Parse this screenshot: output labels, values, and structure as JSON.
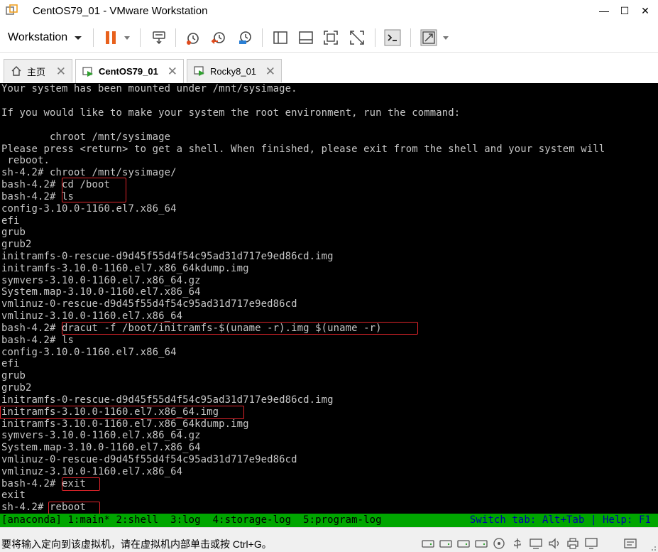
{
  "window": {
    "title": "CentOS79_01 - VMware Workstation",
    "minimize_glyph": "—",
    "maximize_glyph": "☐",
    "close_glyph": "✕"
  },
  "toolbar": {
    "workstation_menu_label": "Workstation",
    "buttons": [
      "pause-icon",
      "send-ctrl-alt-del-icon",
      "snapshot-take-icon",
      "snapshot-revert-icon",
      "snapshot-manager-icon",
      "show-library-icon",
      "thumbnail-bar-icon",
      "full-screen-icon",
      "unity-icon",
      "console-view-icon",
      "stretch-guest-icon"
    ]
  },
  "tabs": [
    {
      "label": "主页",
      "icon": "home-icon",
      "active": false
    },
    {
      "label": "CentOS79_01",
      "icon": "vm-running-icon",
      "active": true
    },
    {
      "label": "Rocky8_01",
      "icon": "vm-running-icon",
      "active": false
    }
  ],
  "console": {
    "lines": [
      "Your system has been mounted under /mnt/sysimage.",
      "",
      "If you would like to make your system the root environment, run the command:",
      "",
      "        chroot /mnt/sysimage",
      "Please press <return> to get a shell. When finished, please exit from the shell and your system will",
      " reboot.",
      "sh-4.2# chroot /mnt/sysimage/",
      "bash-4.2# cd /boot",
      "bash-4.2# ls",
      "config-3.10.0-1160.el7.x86_64",
      "efi",
      "grub",
      "grub2",
      "initramfs-0-rescue-d9d45f55d4f54c95ad31d717e9ed86cd.img",
      "initramfs-3.10.0-1160.el7.x86_64kdump.img",
      "symvers-3.10.0-1160.el7.x86_64.gz",
      "System.map-3.10.0-1160.el7.x86_64",
      "vmlinuz-0-rescue-d9d45f55d4f54c95ad31d717e9ed86cd",
      "vmlinuz-3.10.0-1160.el7.x86_64",
      "bash-4.2# dracut -f /boot/initramfs-$(uname -r).img $(uname -r)",
      "bash-4.2# ls",
      "config-3.10.0-1160.el7.x86_64",
      "efi",
      "grub",
      "grub2",
      "initramfs-0-rescue-d9d45f55d4f54c95ad31d717e9ed86cd.img",
      "initramfs-3.10.0-1160.el7.x86_64.img",
      "initramfs-3.10.0-1160.el7.x86_64kdump.img",
      "symvers-3.10.0-1160.el7.x86_64.gz",
      "System.map-3.10.0-1160.el7.x86_64",
      "vmlinuz-0-rescue-d9d45f55d4f54c95ad31d717e9ed86cd",
      "vmlinuz-3.10.0-1160.el7.x86_64",
      "bash-4.2# exit",
      "exit",
      "sh-4.2# reboot"
    ],
    "tmux_status_left": "[anaconda] 1:main* 2:shell  3:log  4:storage-log  5:program-log",
    "tmux_status_right": "Switch tab: Alt+Tab | Help: F1",
    "colors": {
      "background": "#000000",
      "text": "#c7c7c7",
      "status_bar": "#00a600",
      "status_right_text": "#0000a8",
      "highlight_box": "#e0242b"
    }
  },
  "statusbar": {
    "hint": "要将输入定向到该虚拟机，请在虚拟机内部单击或按 Ctrl+G。",
    "device_icons": [
      "hard-disk-icon",
      "hard-disk-icon",
      "hard-disk-icon",
      "cd-dvd-icon",
      "usb-controller-icon",
      "network-adapter-icon",
      "sound-card-icon",
      "printer-icon",
      "display-icon",
      "messages-icon"
    ]
  }
}
